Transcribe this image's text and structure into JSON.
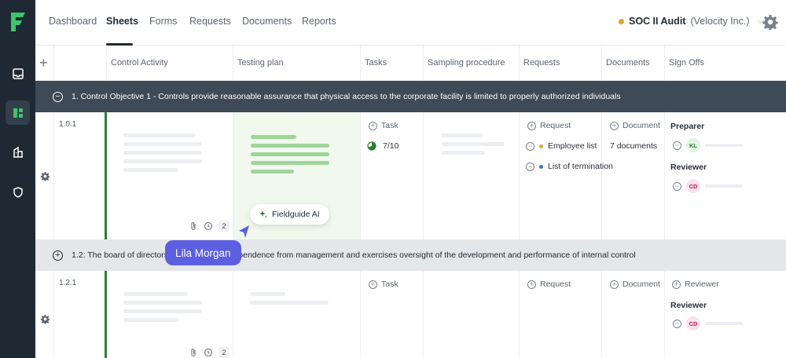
{
  "nav": {
    "tabs": [
      {
        "label": "Dashboard"
      },
      {
        "label": "Sheets"
      },
      {
        "label": "Forms"
      },
      {
        "label": "Requests"
      },
      {
        "label": "Documents"
      },
      {
        "label": "Reports"
      }
    ],
    "active_tab": "Sheets",
    "audit_name": "SOC II Audit",
    "audit_org": "(Velocity Inc.)"
  },
  "columns": [
    "Control Activity",
    "Testing plan",
    "Tasks",
    "Sampling procedure",
    "Requests",
    "Documents",
    "Sign Offs"
  ],
  "sections": [
    {
      "text": "1. Control Objective 1 - Controls provide reasonable assurance that physical access to the corporate facility is limited to properly authorized individuals",
      "toggle": "−"
    },
    {
      "text": "1.2: The board of directors demonstrates independence from management and exercises oversight of the development and performance of internal control",
      "toggle": "+"
    }
  ],
  "rows": [
    {
      "id": "1.0.1",
      "task_label": "Task",
      "task_progress": "7/10",
      "task_progress_fraction": 0.7,
      "request_label": "Request",
      "requests": [
        {
          "label": "Employee list",
          "color": "#e0a528"
        },
        {
          "label": "List of termination",
          "color": "#3b6fd9"
        }
      ],
      "document_label": "Document",
      "documents_count": "7 documents",
      "preparer_label": "Preparer",
      "preparer_initials": "KL",
      "reviewer_label": "Reviewer",
      "reviewer_initials": "CD",
      "comment_count": "2"
    },
    {
      "id": "1.2.1",
      "task_label": "Task",
      "request_label": "Request",
      "document_label": "Document",
      "reviewer_add_label": "Reviewer",
      "reviewer_label": "Reviewer",
      "reviewer_initials": "CD",
      "comment_count": "2"
    }
  ],
  "ai_chip": "Fieldguide AI",
  "cursor_user": "Lila Morgan",
  "colors": {
    "sidebar": "#1f2933",
    "section_dark": "#3e4a56",
    "accent_green": "#2e7d32",
    "cursor": "#5b5fe0",
    "audit_dot": "#e0a528"
  }
}
